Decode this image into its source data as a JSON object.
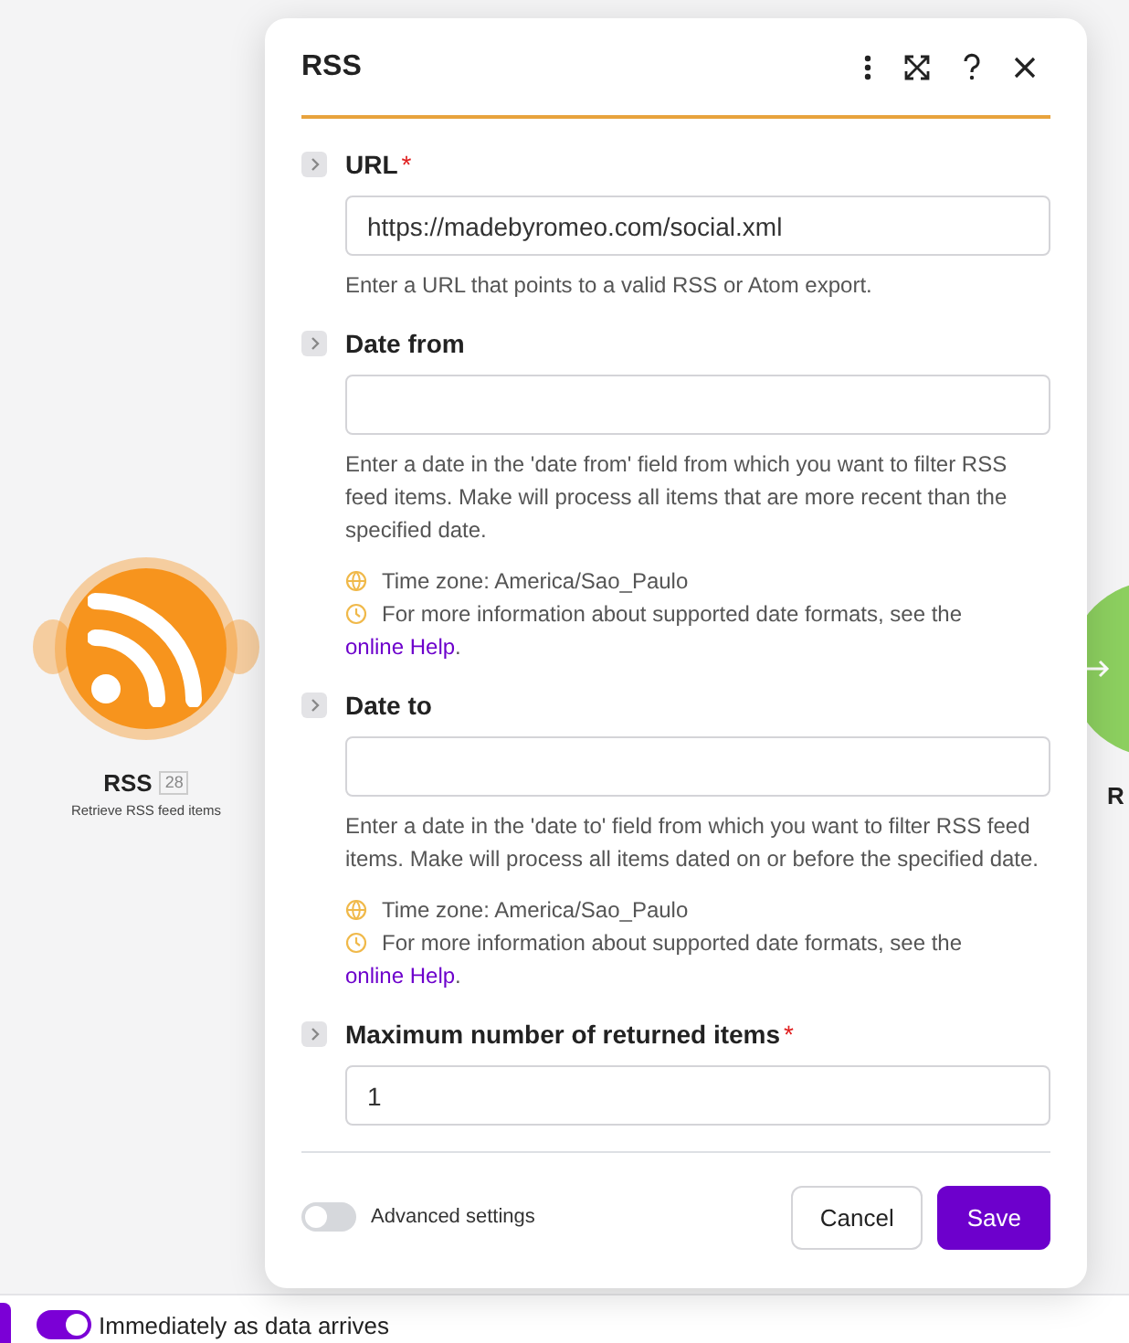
{
  "canvas": {
    "nodes": [
      {
        "kind": "rss",
        "title": "RSS",
        "badge": "28",
        "subtitle": "Retrieve RSS feed items",
        "color": "#f7941d"
      },
      {
        "kind": "partial",
        "title": "R",
        "color": "#8ccf5f"
      }
    ]
  },
  "dialog": {
    "title": "RSS",
    "fields": [
      {
        "label": "URL",
        "required_mark": "*",
        "value": "https://madebyromeo.com/social.xml",
        "help": "Enter a URL that points to a valid RSS or Atom export."
      },
      {
        "label": "Date from",
        "help": "Enter a date in the 'date from' field from which you want to filter RSS feed items. Make will process all items that are more recent than the specified date.",
        "timezone": "Time zone: America/Sao_Paulo",
        "info": "For more information about supported date formats, see the",
        "link": "online Help",
        "after_link": "."
      },
      {
        "label": "Date to",
        "help": "Enter a date in the 'date to' field from which you want to filter RSS feed items. Make will process all items dated on or before the specified date.",
        "timezone": "Time zone: America/Sao_Paulo",
        "info": "For more information about supported date formats, see the",
        "link": "online Help",
        "after_link": "."
      },
      {
        "label": "Maximum number of returned items",
        "required_mark": "*",
        "value": "1"
      }
    ],
    "advanced": {
      "label": "Advanced settings",
      "on": false
    },
    "buttons": [
      {
        "kind": "secondary",
        "label": "Cancel"
      },
      {
        "kind": "primary",
        "label": "Save"
      }
    ]
  },
  "bottom_bar": {
    "schedule": {
      "label": "Immediately as data arrives",
      "on": true
    }
  }
}
